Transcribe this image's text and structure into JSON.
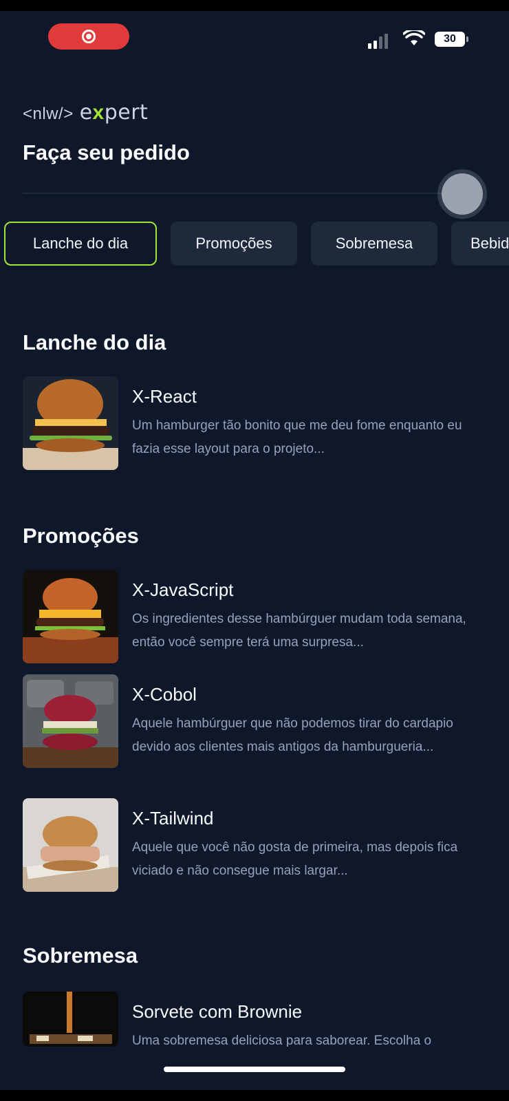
{
  "status_bar": {
    "battery": "30"
  },
  "header": {
    "logo_prefix": "<nlw/>",
    "logo_e": "e",
    "logo_x": "x",
    "logo_rest": "pert",
    "title": "Faça seu pedido"
  },
  "categories": [
    {
      "label": "Lanche do dia",
      "active": true
    },
    {
      "label": "Promoções",
      "active": false
    },
    {
      "label": "Sobremesa",
      "active": false
    },
    {
      "label": "Bebidas",
      "active": false
    }
  ],
  "sections": [
    {
      "title": "Lanche do dia",
      "items": [
        {
          "name": "X-React",
          "description": "Um hamburger tão bonito que me deu fome enquanto eu fazia esse layout para o projeto..."
        }
      ]
    },
    {
      "title": "Promoções",
      "items": [
        {
          "name": "X-JavaScript",
          "description": "Os ingredientes desse hambúrguer mudam toda semana, então você sempre terá uma surpresa..."
        },
        {
          "name": "X-Cobol",
          "description": "Aquele hambúrguer que não podemos tirar do cardapio devido aos clientes mais antigos da hamburgueria..."
        },
        {
          "name": "X-Tailwind",
          "description": "Aquele que você não gosta de primeira, mas depois fica viciado e não consegue mais largar..."
        }
      ]
    },
    {
      "title": "Sobremesa",
      "items": [
        {
          "name": "Sorvete com Brownie",
          "description": "Uma sobremesa deliciosa para saborear. Escolha o"
        }
      ]
    }
  ],
  "colors": {
    "background": "#0f172a",
    "accent": "#a3e635",
    "chip": "#1e293b",
    "muted": "#94a3b8"
  },
  "icons": [
    "screen-record-icon",
    "cellular-signal-icon",
    "wifi-icon",
    "battery-icon"
  ]
}
